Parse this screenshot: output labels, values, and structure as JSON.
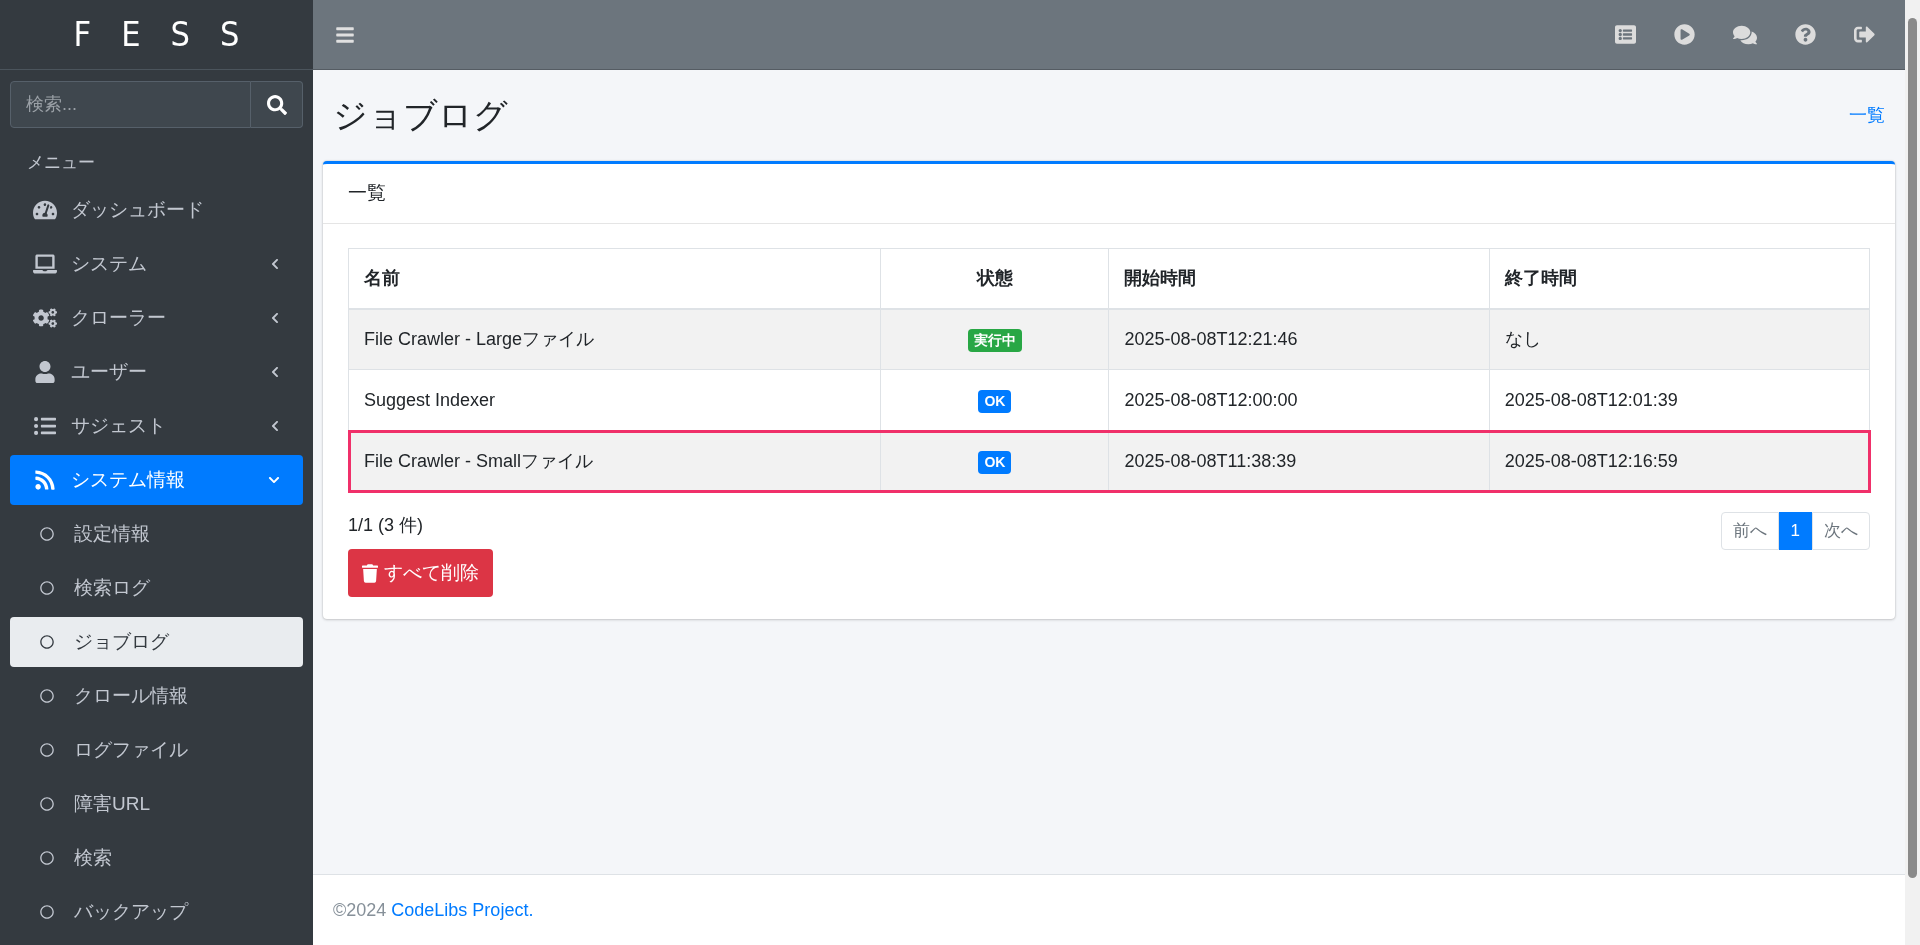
{
  "sidebar": {
    "logo": "FESS",
    "search": {
      "placeholder": "検索..."
    },
    "menu_heading": "メニュー",
    "items": [
      {
        "label": "ダッシュボード",
        "selected": false
      },
      {
        "label": "システム",
        "selected": false,
        "expanded": false
      },
      {
        "label": "クローラー",
        "selected": false,
        "expanded": false
      },
      {
        "label": "ユーザー",
        "selected": false,
        "expanded": false
      },
      {
        "label": "サジェスト",
        "selected": false,
        "expanded": false
      },
      {
        "label": "システム情報",
        "selected": true,
        "expanded": true,
        "children": [
          {
            "label": "設定情報",
            "selected": false
          },
          {
            "label": "検索ログ",
            "selected": false
          },
          {
            "label": "ジョブログ",
            "selected": true
          },
          {
            "label": "クロール情報",
            "selected": false
          },
          {
            "label": "ログファイル",
            "selected": false
          },
          {
            "label": "障害URL",
            "selected": false
          },
          {
            "label": "検索",
            "selected": false
          },
          {
            "label": "バックアップ",
            "selected": false
          }
        ]
      }
    ]
  },
  "page": {
    "title": "ジョブログ",
    "breadcrumb_link": "一覧"
  },
  "card": {
    "header": "一覧",
    "table": {
      "columns": [
        "名前",
        "状態",
        "開始時間",
        "終了時間"
      ],
      "rows": [
        {
          "name": "File Crawler - Largeファイル",
          "status": "実行中",
          "color": "#28a745",
          "start": "2025-08-08T12:21:46",
          "end": "なし",
          "highlighted": false
        },
        {
          "name": "Suggest Indexer",
          "status": "OK",
          "color": "#007bff",
          "start": "2025-08-08T12:00:00",
          "end": "2025-08-08T12:01:39",
          "highlighted": false
        },
        {
          "name": "File Crawler - Smallファイル",
          "status": "OK",
          "color": "#007bff",
          "start": "2025-08-08T11:38:39",
          "end": "2025-08-08T12:16:59",
          "highlighted": true
        }
      ]
    },
    "page_info": "1/1 (3 件)",
    "delete_all_button": "すべて削除",
    "pagination": [
      {
        "label": "前へ",
        "selected": false
      },
      {
        "label": "1",
        "selected": true
      },
      {
        "label": "次へ",
        "selected": false
      }
    ]
  },
  "footer": {
    "copyright": "©2024 ",
    "link": "CodeLibs Project."
  }
}
